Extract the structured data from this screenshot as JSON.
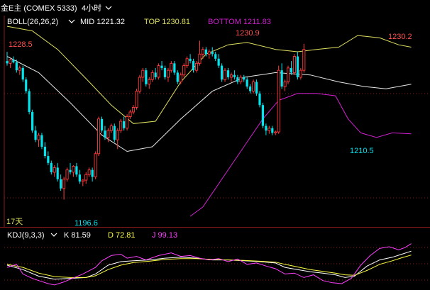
{
  "header": {
    "instrument": "金E主 (COMEX 5333)",
    "period": "4小时"
  },
  "boll": {
    "label": "BOLL(26,26,2)",
    "mid": "MID 1221.32",
    "top": "TOP 1230.81",
    "bottom": "BOTTOM 1211.83"
  },
  "kdj": {
    "label": "KDJ(9,3,3)",
    "k": "K 81.59",
    "d": "D 72.81",
    "j": "J 99.13"
  },
  "day_label": "17天",
  "annotations": {
    "high_left": "1228.5",
    "high_mid": "1230.9",
    "high_right": "1230.2",
    "low_left": "1196.6",
    "low_right": "1210.5"
  },
  "colors": {
    "up": "#ff3b3b",
    "down": "#00e5ee",
    "top_band": "#e0e060",
    "mid_band": "#e8e8e8",
    "bottom_band": "#d020d0",
    "k_line": "#ffffff",
    "d_line": "#ffff40",
    "j_line": "#ff40ff",
    "grid": "#8b1a1a"
  },
  "chart_data": [
    {
      "type": "candlestick",
      "ylim": [
        1193,
        1236
      ],
      "candles": [
        [
          1226.5,
          1228.5,
          1225.5,
          1226.0
        ],
        [
          1226.0,
          1227.0,
          1225.0,
          1226.8
        ],
        [
          1226.8,
          1227.5,
          1226.0,
          1226.2
        ],
        [
          1226.2,
          1226.8,
          1224.0,
          1224.5
        ],
        [
          1224.5,
          1225.5,
          1223.5,
          1225.0
        ],
        [
          1225.0,
          1225.5,
          1222.0,
          1222.5
        ],
        [
          1222.5,
          1223.0,
          1219.5,
          1220.0
        ],
        [
          1220.0,
          1220.5,
          1215.0,
          1215.5
        ],
        [
          1215.5,
          1216.0,
          1211.0,
          1211.5
        ],
        [
          1211.5,
          1212.5,
          1209.0,
          1209.5
        ],
        [
          1209.5,
          1211.0,
          1208.0,
          1210.5
        ],
        [
          1210.5,
          1211.0,
          1207.5,
          1208.0
        ],
        [
          1208.0,
          1209.0,
          1205.5,
          1206.0
        ],
        [
          1206.0,
          1207.0,
          1204.0,
          1204.5
        ],
        [
          1204.5,
          1205.0,
          1202.0,
          1202.5
        ],
        [
          1202.5,
          1204.0,
          1201.5,
          1203.5
        ],
        [
          1203.5,
          1204.5,
          1200.5,
          1201.0
        ],
        [
          1201.0,
          1202.0,
          1198.5,
          1199.0
        ],
        [
          1199.0,
          1201.5,
          1196.6,
          1201.0
        ],
        [
          1201.0,
          1203.5,
          1200.5,
          1203.0
        ],
        [
          1203.0,
          1204.5,
          1202.0,
          1202.5
        ],
        [
          1202.5,
          1204.0,
          1201.5,
          1203.8
        ],
        [
          1203.8,
          1204.5,
          1201.5,
          1202.0
        ],
        [
          1202.0,
          1203.0,
          1200.0,
          1200.5
        ],
        [
          1200.5,
          1201.0,
          1199.5,
          1200.8
        ],
        [
          1200.8,
          1202.5,
          1200.0,
          1202.0
        ],
        [
          1202.0,
          1203.5,
          1201.5,
          1203.0
        ],
        [
          1203.0,
          1203.5,
          1200.5,
          1201.5
        ],
        [
          1201.5,
          1207.0,
          1201.0,
          1206.5
        ],
        [
          1206.5,
          1214.5,
          1206.0,
          1214.0
        ],
        [
          1214.0,
          1214.5,
          1211.0,
          1211.5
        ],
        [
          1211.5,
          1212.5,
          1209.5,
          1210.0
        ],
        [
          1210.0,
          1212.0,
          1209.0,
          1211.5
        ],
        [
          1211.5,
          1213.0,
          1211.0,
          1212.5
        ],
        [
          1212.5,
          1213.0,
          1209.0,
          1209.5
        ],
        [
          1209.5,
          1212.0,
          1207.5,
          1211.5
        ],
        [
          1211.5,
          1214.0,
          1211.0,
          1213.5
        ],
        [
          1213.5,
          1214.5,
          1211.5,
          1212.0
        ],
        [
          1212.0,
          1215.0,
          1211.5,
          1214.5
        ],
        [
          1214.5,
          1216.0,
          1214.0,
          1215.5
        ],
        [
          1215.5,
          1217.0,
          1215.0,
          1216.5
        ],
        [
          1216.5,
          1220.5,
          1216.0,
          1220.0
        ],
        [
          1220.0,
          1223.5,
          1219.5,
          1223.0
        ],
        [
          1223.0,
          1225.0,
          1222.0,
          1224.5
        ],
        [
          1224.5,
          1225.0,
          1221.0,
          1221.5
        ],
        [
          1221.5,
          1223.0,
          1220.5,
          1222.5
        ],
        [
          1222.5,
          1224.5,
          1222.0,
          1224.0
        ],
        [
          1224.0,
          1225.0,
          1222.5,
          1223.0
        ],
        [
          1223.0,
          1226.0,
          1222.5,
          1225.5
        ],
        [
          1225.5,
          1226.5,
          1224.5,
          1225.0
        ],
        [
          1225.0,
          1225.5,
          1222.5,
          1223.0
        ],
        [
          1223.0,
          1225.0,
          1222.0,
          1224.5
        ],
        [
          1224.5,
          1226.5,
          1224.0,
          1226.0
        ],
        [
          1226.0,
          1226.5,
          1223.5,
          1224.0
        ],
        [
          1224.0,
          1224.5,
          1221.5,
          1222.0
        ],
        [
          1222.0,
          1224.0,
          1221.5,
          1223.5
        ],
        [
          1223.5,
          1226.0,
          1223.0,
          1225.5
        ],
        [
          1225.5,
          1227.5,
          1225.0,
          1227.0
        ],
        [
          1227.0,
          1228.0,
          1226.0,
          1226.5
        ],
        [
          1226.5,
          1227.0,
          1224.0,
          1224.5
        ],
        [
          1224.5,
          1226.5,
          1224.0,
          1226.0
        ],
        [
          1226.0,
          1230.9,
          1225.5,
          1228.0
        ],
        [
          1228.0,
          1229.5,
          1227.0,
          1229.0
        ],
        [
          1229.0,
          1229.5,
          1227.5,
          1228.0
        ],
        [
          1228.0,
          1229.0,
          1227.0,
          1228.5
        ],
        [
          1228.5,
          1229.5,
          1227.5,
          1228.0
        ],
        [
          1228.0,
          1228.5,
          1226.5,
          1227.0
        ],
        [
          1227.0,
          1228.0,
          1225.0,
          1225.5
        ],
        [
          1225.5,
          1226.0,
          1222.0,
          1222.5
        ],
        [
          1222.5,
          1225.0,
          1222.0,
          1224.5
        ],
        [
          1224.5,
          1225.0,
          1222.5,
          1223.0
        ],
        [
          1223.0,
          1224.0,
          1222.0,
          1223.5
        ],
        [
          1223.5,
          1224.5,
          1222.5,
          1223.0
        ],
        [
          1223.0,
          1223.5,
          1221.5,
          1222.0
        ],
        [
          1222.0,
          1223.5,
          1221.5,
          1223.0
        ],
        [
          1223.0,
          1223.5,
          1222.0,
          1222.5
        ],
        [
          1222.5,
          1223.0,
          1220.5,
          1221.0
        ],
        [
          1221.0,
          1221.5,
          1219.5,
          1220.0
        ],
        [
          1220.0,
          1222.5,
          1219.5,
          1222.0
        ],
        [
          1222.0,
          1222.5,
          1219.0,
          1219.5
        ],
        [
          1219.5,
          1220.0,
          1216.5,
          1217.0
        ],
        [
          1217.0,
          1217.5,
          1212.0,
          1212.5
        ],
        [
          1212.5,
          1213.0,
          1210.5,
          1211.5
        ],
        [
          1211.5,
          1212.5,
          1210.8,
          1212.0
        ],
        [
          1212.0,
          1212.5,
          1210.5,
          1211.0
        ],
        [
          1211.0,
          1211.5,
          1210.5,
          1211.2
        ],
        [
          1211.2,
          1225.5,
          1210.8,
          1224.5
        ],
        [
          1224.5,
          1226.0,
          1220.5,
          1221.0
        ],
        [
          1221.0,
          1222.5,
          1220.0,
          1222.0
        ],
        [
          1222.0,
          1225.5,
          1221.5,
          1225.0
        ],
        [
          1225.0,
          1226.5,
          1223.5,
          1224.0
        ],
        [
          1224.0,
          1228.0,
          1223.5,
          1227.5
        ],
        [
          1227.5,
          1228.5,
          1222.5,
          1223.0
        ],
        [
          1223.0,
          1225.0,
          1222.5,
          1224.5
        ],
        [
          1224.5,
          1230.2,
          1224.0,
          1229.0
        ]
      ],
      "mid": [
        [
          0,
          1227.5
        ],
        [
          10,
          1224.0
        ],
        [
          20,
          1217.5
        ],
        [
          30,
          1210.5
        ],
        [
          38,
          1207.0
        ],
        [
          46,
          1208.0
        ],
        [
          55,
          1214.0
        ],
        [
          65,
          1220.0
        ],
        [
          75,
          1223.0
        ],
        [
          85,
          1224.0
        ],
        [
          96,
          1223.5
        ],
        [
          105,
          1222.0
        ],
        [
          113,
          1221.0
        ],
        [
          120,
          1220.5
        ],
        [
          128,
          1221.5
        ]
      ],
      "top": [
        [
          0,
          1234.0
        ],
        [
          8,
          1233.0
        ],
        [
          16,
          1229.0
        ],
        [
          26,
          1222.0
        ],
        [
          33,
          1217.0
        ],
        [
          40,
          1213.0
        ],
        [
          47,
          1213.5
        ],
        [
          55,
          1222.0
        ],
        [
          63,
          1228.0
        ],
        [
          70,
          1230.0
        ],
        [
          76,
          1230.5
        ],
        [
          85,
          1229.0
        ],
        [
          92,
          1228.5
        ],
        [
          98,
          1229.0
        ],
        [
          105,
          1229.5
        ],
        [
          111,
          1232.0
        ],
        [
          118,
          1231.5
        ],
        [
          124,
          1230.0
        ],
        [
          128,
          1229.5
        ]
      ],
      "bottom": [
        [
          58,
          1193.0
        ],
        [
          62,
          1195.0
        ],
        [
          66,
          1199.0
        ],
        [
          71,
          1204.0
        ],
        [
          76,
          1209.0
        ],
        [
          81,
          1214.0
        ],
        [
          86,
          1218.0
        ],
        [
          92,
          1219.5
        ],
        [
          98,
          1219.5
        ],
        [
          104,
          1219.0
        ],
        [
          108,
          1214.0
        ],
        [
          112,
          1211.0
        ],
        [
          117,
          1210.0
        ],
        [
          122,
          1211.0
        ],
        [
          128,
          1210.8
        ]
      ]
    },
    {
      "type": "line",
      "title": "KDJ(9,3,3)",
      "ylim": [
        0,
        100
      ],
      "series": [
        {
          "name": "K",
          "values": [
            [
              0,
              50
            ],
            [
              5,
              40
            ],
            [
              10,
              25
            ],
            [
              15,
              18
            ],
            [
              20,
              20
            ],
            [
              25,
              22
            ],
            [
              28,
              30
            ],
            [
              32,
              50
            ],
            [
              36,
              58
            ],
            [
              40,
              60
            ],
            [
              45,
              62
            ],
            [
              50,
              66
            ],
            [
              55,
              68
            ],
            [
              60,
              66
            ],
            [
              65,
              62
            ],
            [
              70,
              62
            ],
            [
              75,
              60
            ],
            [
              80,
              58
            ],
            [
              85,
              55
            ],
            [
              88,
              45
            ],
            [
              92,
              40
            ],
            [
              96,
              35
            ],
            [
              100,
              32
            ],
            [
              104,
              28
            ],
            [
              107,
              22
            ],
            [
              110,
              25
            ],
            [
              114,
              48
            ],
            [
              118,
              62
            ],
            [
              122,
              68
            ],
            [
              125,
              75
            ],
            [
              128,
              82
            ]
          ]
        },
        {
          "name": "D",
          "values": [
            [
              0,
              52
            ],
            [
              5,
              45
            ],
            [
              10,
              32
            ],
            [
              15,
              24
            ],
            [
              20,
              22
            ],
            [
              25,
              22
            ],
            [
              28,
              26
            ],
            [
              32,
              40
            ],
            [
              36,
              50
            ],
            [
              40,
              56
            ],
            [
              45,
              59
            ],
            [
              50,
              63
            ],
            [
              55,
              65
            ],
            [
              60,
              65
            ],
            [
              65,
              63
            ],
            [
              70,
              62
            ],
            [
              75,
              61
            ],
            [
              80,
              59
            ],
            [
              85,
              57
            ],
            [
              88,
              52
            ],
            [
              92,
              46
            ],
            [
              96,
              40
            ],
            [
              100,
              36
            ],
            [
              104,
              32
            ],
            [
              107,
              28
            ],
            [
              110,
              27
            ],
            [
              114,
              38
            ],
            [
              118,
              52
            ],
            [
              122,
              60
            ],
            [
              125,
              67
            ],
            [
              128,
              73
            ]
          ]
        },
        {
          "name": "J",
          "values": [
            [
              0,
              45
            ],
            [
              3,
              52
            ],
            [
              5,
              30
            ],
            [
              8,
              20
            ],
            [
              10,
              15
            ],
            [
              13,
              8
            ],
            [
              15,
              5
            ],
            [
              18,
              12
            ],
            [
              20,
              18
            ],
            [
              24,
              30
            ],
            [
              28,
              45
            ],
            [
              30,
              60
            ],
            [
              33,
              72
            ],
            [
              36,
              75
            ],
            [
              38,
              66
            ],
            [
              41,
              70
            ],
            [
              44,
              62
            ],
            [
              48,
              72
            ],
            [
              52,
              78
            ],
            [
              55,
              70
            ],
            [
              58,
              72
            ],
            [
              61,
              66
            ],
            [
              64,
              62
            ],
            [
              67,
              65
            ],
            [
              70,
              58
            ],
            [
              73,
              64
            ],
            [
              76,
              52
            ],
            [
              79,
              55
            ],
            [
              82,
              48
            ],
            [
              85,
              42
            ],
            [
              88,
              30
            ],
            [
              91,
              32
            ],
            [
              94,
              22
            ],
            [
              97,
              28
            ],
            [
              100,
              15
            ],
            [
              103,
              10
            ],
            [
              106,
              8
            ],
            [
              109,
              20
            ],
            [
              112,
              50
            ],
            [
              115,
              72
            ],
            [
              118,
              88
            ],
            [
              121,
              92
            ],
            [
              124,
              85
            ],
            [
              126,
              90
            ],
            [
              128,
              99
            ]
          ]
        }
      ]
    }
  ]
}
